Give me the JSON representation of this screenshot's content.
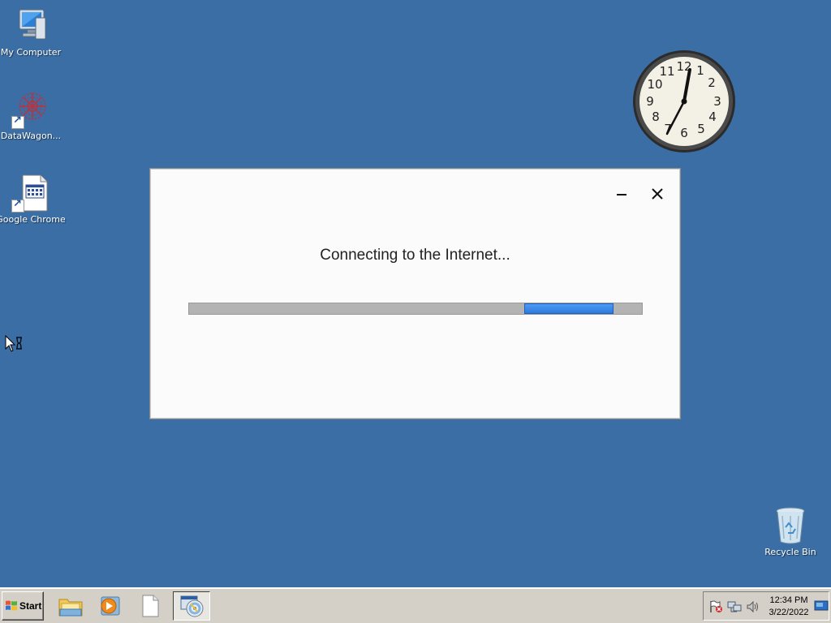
{
  "desktop": {
    "icons": [
      {
        "label": "My Computer"
      },
      {
        "label": "DataWagon..."
      },
      {
        "label": "Google Chrome"
      },
      {
        "label": "Recycle Bin"
      }
    ]
  },
  "dialog": {
    "message": "Connecting to the Internet...",
    "progress_fraction": 0.196
  },
  "clock": {
    "time": "12:34"
  },
  "taskbar": {
    "start_label": "Start",
    "pinned": [
      {
        "icon": "file-explorer-icon"
      },
      {
        "icon": "media-player-icon"
      },
      {
        "icon": "blank-document-icon"
      },
      {
        "icon": "cd-setup-icon",
        "active": true
      }
    ],
    "tray": {
      "icons": [
        "action-center-flag-icon",
        "network-icon",
        "volume-icon"
      ],
      "time": "12:34 PM",
      "date": "3/22/2022"
    }
  },
  "colors": {
    "desktop_bg": "#3a6ea5",
    "progress_fill": "#3b8ae8",
    "taskbar": "#d4d0c8"
  }
}
